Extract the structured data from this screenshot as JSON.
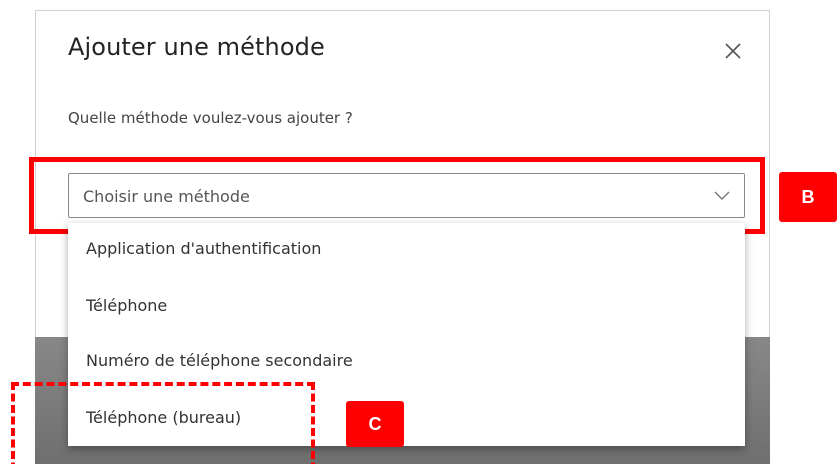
{
  "dialog": {
    "title": "Ajouter une méthode",
    "question": "Quelle méthode voulez-vous ajouter ?",
    "close_icon": "close-icon"
  },
  "select": {
    "value": "Choisir une méthode",
    "icon": "chevron-down-icon"
  },
  "options": [
    {
      "label": "Application d'authentification"
    },
    {
      "label": "Téléphone"
    },
    {
      "label": "Numéro de téléphone secondaire"
    },
    {
      "label": "Téléphone (bureau)"
    }
  ],
  "annotations": {
    "b_label": "B",
    "c_label": "C",
    "highlight_color": "#ff0000"
  }
}
